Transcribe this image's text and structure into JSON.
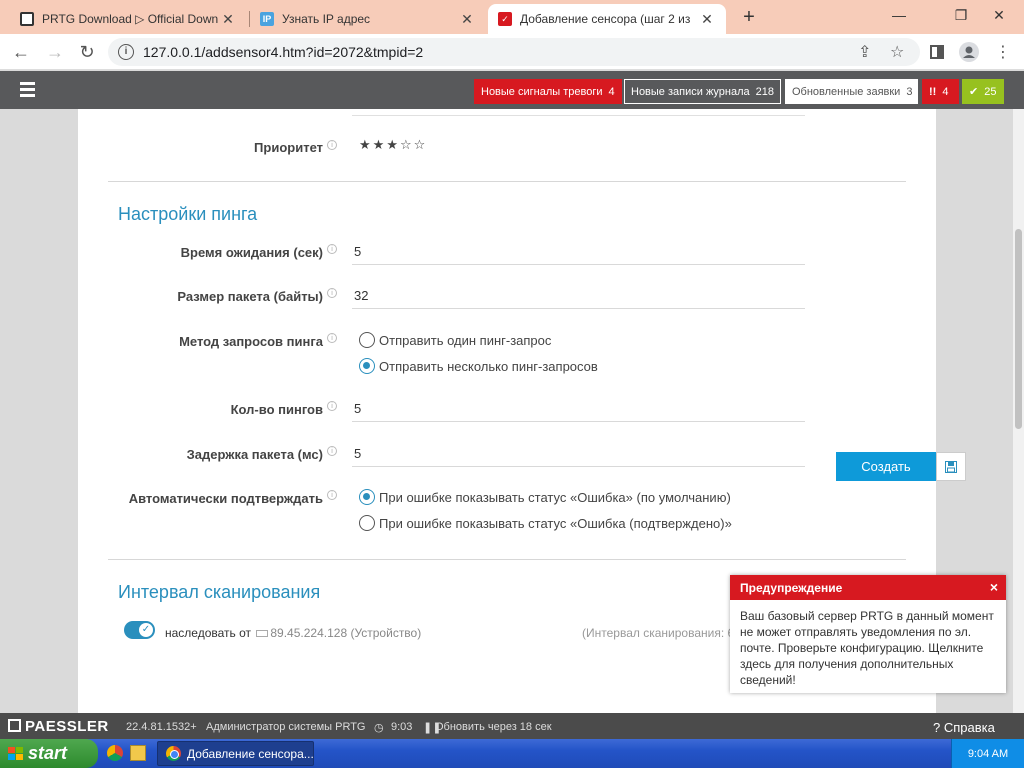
{
  "browser": {
    "tabs": [
      {
        "title": "PRTG Download ▷ Official Down",
        "favicon": "prtg-favicon"
      },
      {
        "title": "Узнать IP адрес",
        "favicon_text": "IP"
      },
      {
        "title": "Добавление сенсора (шаг 2 из",
        "favicon": "prtg-red-favicon"
      }
    ],
    "url": "127.0.0.1/addsensor4.htm?id=2072&tmpid=2"
  },
  "header": {
    "alarm_label": "Новые сигналы тревоги",
    "alarm_count": "4",
    "log_label": "Новые записи журнала",
    "log_count": "218",
    "tickets_label": "Обновленные заявки",
    "tickets_count": "3",
    "error_icon": "!!",
    "error_count": "4",
    "ok_count": "25",
    "colors": {
      "alarm": "#d71920",
      "ok": "#97c11f",
      "header_bg": "#58595b"
    }
  },
  "priority": {
    "label": "Приоритет",
    "stars_filled": 3,
    "stars_total": 5
  },
  "ping_settings": {
    "title": "Настройки пинга",
    "timeout": {
      "label": "Время ожидания (сек)",
      "value": "5"
    },
    "packet_size": {
      "label": "Размер пакета (байты)",
      "value": "32"
    },
    "method": {
      "label": "Метод запросов пинга",
      "options": [
        "Отправить один пинг-запрос",
        "Отправить несколько пинг-запросов"
      ],
      "selected": 1
    },
    "ping_count": {
      "label": "Кол-во пингов",
      "value": "5"
    },
    "packet_delay": {
      "label": "Задержка пакета (мс)",
      "value": "5"
    },
    "auto_ack": {
      "label": "Автоматически подтверждать",
      "options": [
        "При ошибке показывать статус «Ошибка» (по умолчанию)",
        "При ошибке показывать статус «Ошибка (подтверждено)»"
      ],
      "selected": 0
    }
  },
  "actions": {
    "create_label": "Создать"
  },
  "scan_interval": {
    "title": "Интервал сканирования",
    "inherit_label": "наследовать от",
    "inherit_source": "89.45.224.128 (Устройство)",
    "info": "(Интервал сканирования: 6"
  },
  "warning": {
    "title": "Предупреждение",
    "close": "×",
    "text": "Ваш базовый сервер PRTG в данный момент не может отправлять уведомления по эл. почте. Проверьте конфигурацию. Щелкните здесь для получения дополнительных сведений!"
  },
  "footer": {
    "logo": "PAESSLER",
    "version": "22.4.81.1532+",
    "user": "Администратор системы PRTG",
    "time": "9:03",
    "refresh": "Обновить через 18 сек",
    "help": "? Справка"
  },
  "taskbar": {
    "start_label": "start",
    "task_label": "Добавление сенсора...",
    "clock": "9:04 AM"
  }
}
